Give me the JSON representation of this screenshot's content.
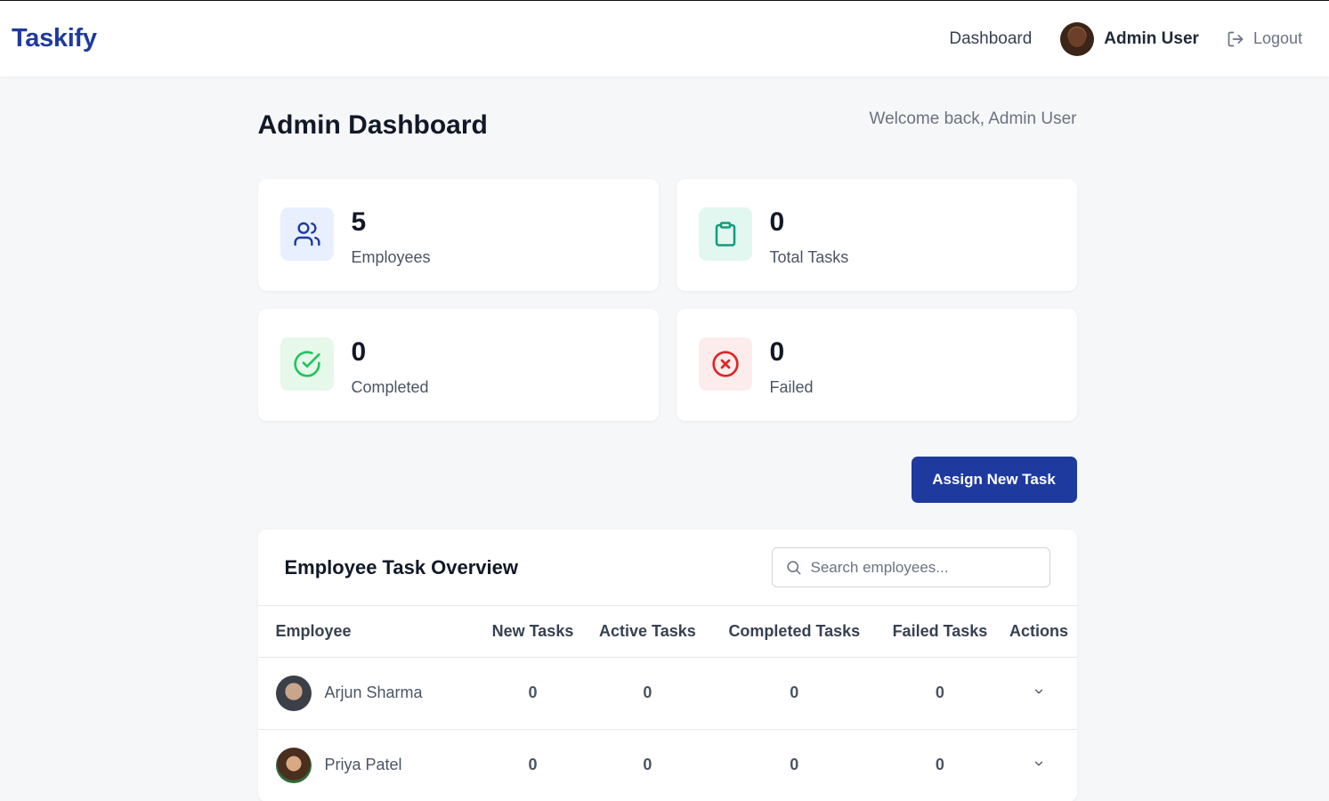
{
  "header": {
    "brand": "Taskify",
    "nav_dashboard": "Dashboard",
    "user_name": "Admin User",
    "logout": "Logout"
  },
  "page": {
    "title": "Admin Dashboard",
    "welcome": "Welcome back, Admin User"
  },
  "stats": [
    {
      "value": "5",
      "label": "Employees",
      "icon": "users-icon",
      "color": "#1e3a9f"
    },
    {
      "value": "0",
      "label": "Total Tasks",
      "icon": "clipboard-icon",
      "color": "#0f9d7a"
    },
    {
      "value": "0",
      "label": "Completed",
      "icon": "check-circle-icon",
      "color": "#22c55e"
    },
    {
      "value": "0",
      "label": "Failed",
      "icon": "x-circle-icon",
      "color": "#dc2626"
    }
  ],
  "actions": {
    "assign_label": "Assign New Task"
  },
  "overview": {
    "title": "Employee Task Overview",
    "search_placeholder": "Search employees...",
    "columns": [
      "Employee",
      "New Tasks",
      "Active Tasks",
      "Completed Tasks",
      "Failed Tasks",
      "Actions"
    ],
    "rows": [
      {
        "name": "Arjun Sharma",
        "new": "0",
        "active": "0",
        "completed": "0",
        "failed": "0"
      },
      {
        "name": "Priya Patel",
        "new": "0",
        "active": "0",
        "completed": "0",
        "failed": "0"
      }
    ]
  },
  "colors": {
    "primary": "#1e3a9f",
    "background": "#f6f7f9"
  }
}
